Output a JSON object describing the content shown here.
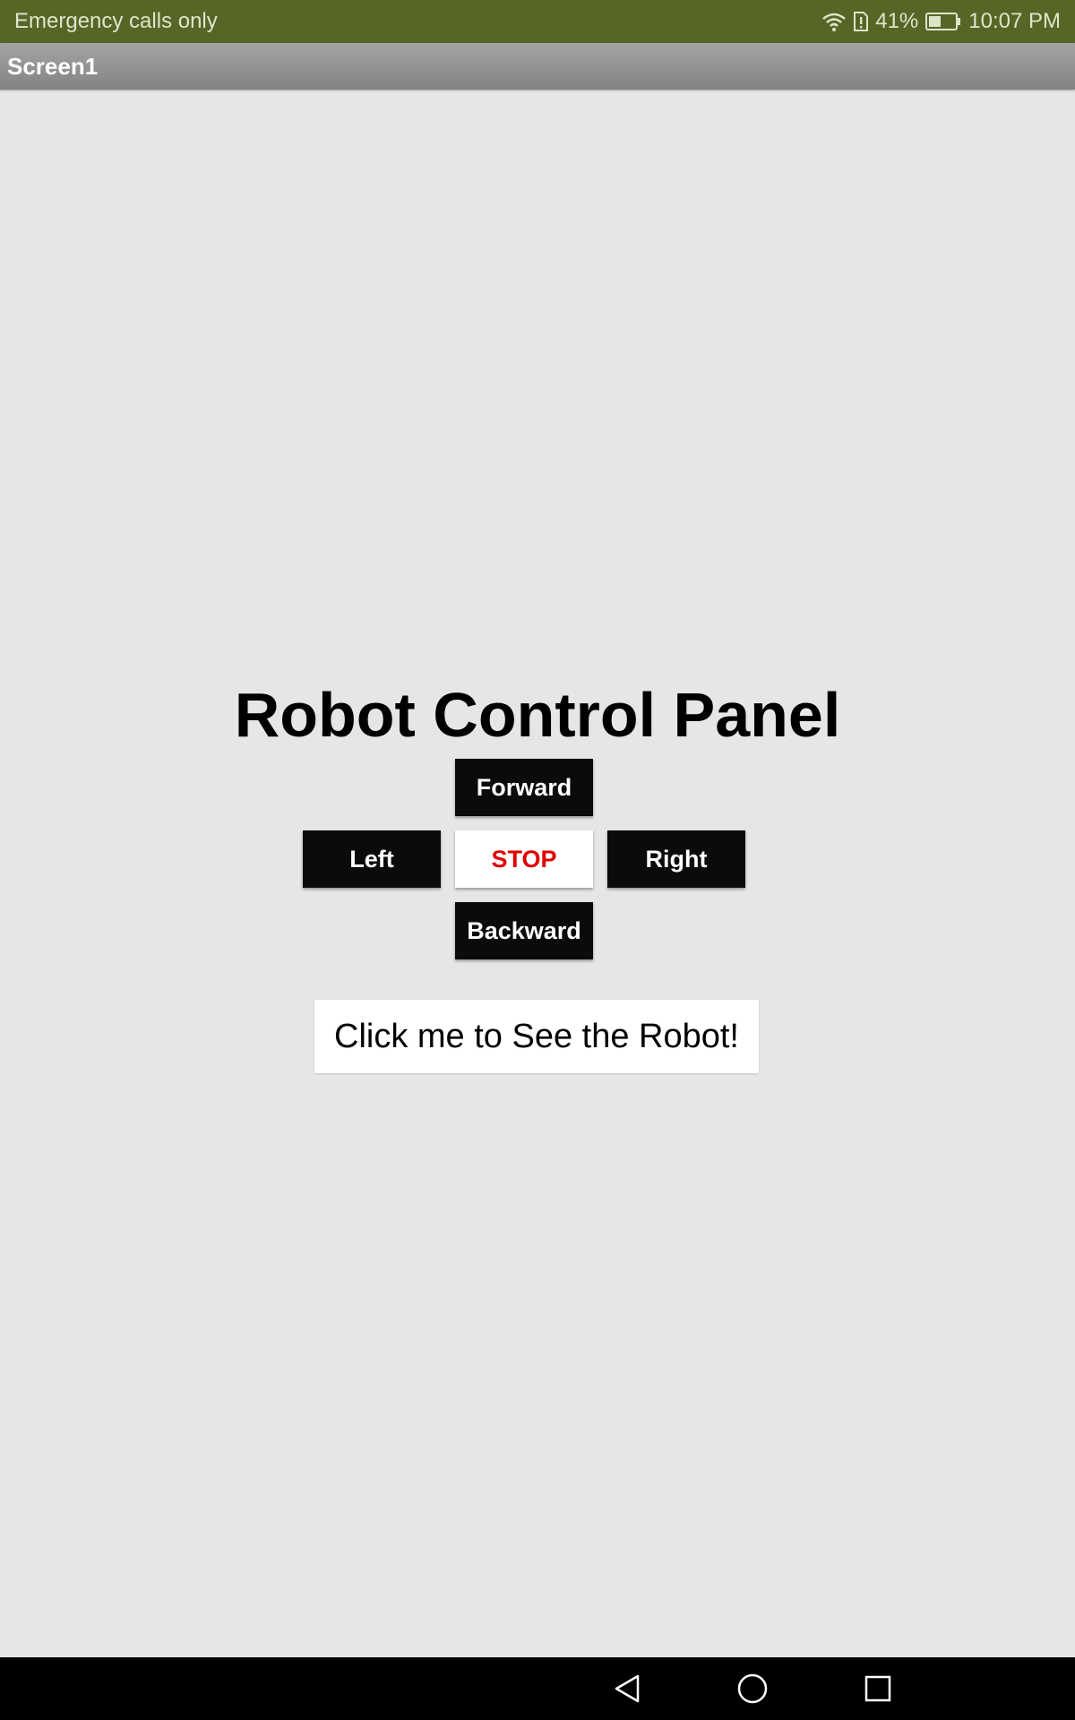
{
  "status_bar": {
    "carrier_text": "Emergency calls only",
    "battery_percent": "41%",
    "time": "10:07 PM",
    "icons": [
      "wifi-icon",
      "sim-alert-icon",
      "battery-icon"
    ]
  },
  "title_bar": {
    "title": "Screen1"
  },
  "main": {
    "heading": "Robot Control Panel",
    "buttons": {
      "forward": "Forward",
      "left": "Left",
      "stop": "STOP",
      "right": "Right",
      "backward": "Backward"
    },
    "see_robot_button": "Click me to See the Robot!"
  },
  "nav_bar": {
    "icons": [
      "back-icon",
      "home-icon",
      "recent-apps-icon"
    ]
  },
  "colors": {
    "status_bar_bg": "#556627",
    "background": "#e6e6e6",
    "button_dark": "#0b0b0b",
    "stop_text": "#e00000"
  }
}
